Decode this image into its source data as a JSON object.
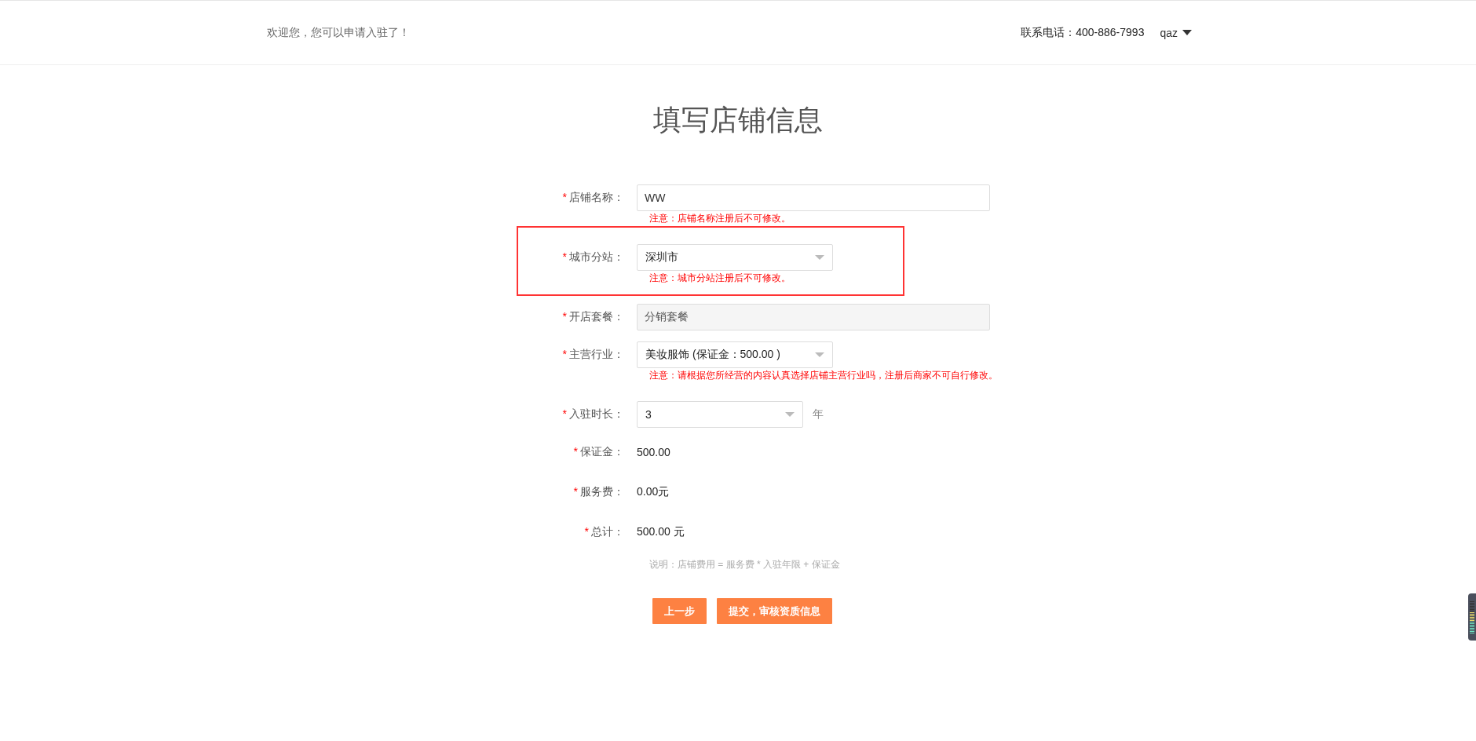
{
  "header": {
    "welcome": "欢迎您，您可以申请入驻了！",
    "phone": "联系电话：400-886-7993",
    "user": "qaz"
  },
  "title": "填写店铺信息",
  "fields": [
    {
      "kind": "text",
      "required_mark": "*",
      "label": "店铺名称：",
      "value": "WW",
      "disabled": false,
      "note": "注意：店铺名称注册后不可修改。"
    },
    {
      "kind": "select",
      "required_mark": "*",
      "label": "城市分站：",
      "value": "深圳市",
      "note": "注意：城市分站注册后不可修改。",
      "highlighted": true
    },
    {
      "kind": "text",
      "required_mark": "*",
      "label": "开店套餐：",
      "value": "分销套餐",
      "disabled": true
    },
    {
      "kind": "select",
      "required_mark": "*",
      "label": "主营行业：",
      "value": "美妆服饰 (保证金：500.00 )",
      "note": "注意：请根据您所经营的内容认真选择店铺主营行业吗，注册后商家不可自行修改。"
    },
    {
      "kind": "select",
      "required_mark": "*",
      "label": "入驻时长：",
      "value": "3",
      "unit": "年"
    },
    {
      "kind": "value",
      "required_mark": "*",
      "label": "保证金：",
      "value": "500.00"
    },
    {
      "kind": "value",
      "required_mark": "*",
      "label": "服务费：",
      "value": "0.00元"
    },
    {
      "kind": "value",
      "required_mark": "*",
      "label": "总计：",
      "value": "500.00 元"
    }
  ],
  "explanation": "说明：店铺费用 = 服务费 * 入驻年限 + 保证金",
  "buttons": [
    {
      "label": "上一步"
    },
    {
      "label": "提交，审核资质信息"
    }
  ]
}
